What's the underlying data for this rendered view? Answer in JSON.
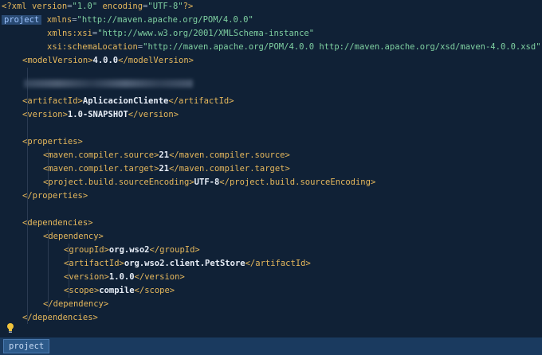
{
  "xml_decl": {
    "open": "<?",
    "name": "xml",
    "version_attr": "version",
    "version_val": "\"1.0\"",
    "encoding_attr": "encoding",
    "encoding_val": "\"UTF-8\"",
    "close": "?>"
  },
  "project": {
    "tag": "project",
    "xmlns_attr": "xmlns",
    "xmlns_val": "\"http://maven.apache.org/POM/4.0.0\"",
    "xsi_attr": "xmlns:xsi",
    "xsi_val": "\"http://www.w3.org/2001/XMLSchema-instance\"",
    "schema_attr": "xsi:schemaLocation",
    "schema_val": "\"http://maven.apache.org/POM/4.0.0 http://maven.apache.org/xsd/maven-4.0.0.xsd\""
  },
  "modelVersion": {
    "tag": "modelVersion",
    "value": "4.0.0"
  },
  "artifactId": {
    "tag": "artifactId",
    "value": "AplicacionCliente"
  },
  "version": {
    "tag": "version",
    "value": "1.0-SNAPSHOT"
  },
  "properties": {
    "tag": "properties",
    "items": [
      {
        "tag": "maven.compiler.source",
        "value": "21"
      },
      {
        "tag": "maven.compiler.target",
        "value": "21"
      },
      {
        "tag": "project.build.sourceEncoding",
        "value": "UTF-8"
      }
    ]
  },
  "dependencies": {
    "tag": "dependencies",
    "dependency_tag": "dependency",
    "groupId": {
      "tag": "groupId",
      "value": "org.wso2"
    },
    "artifactId": {
      "tag": "artifactId",
      "value": "org.wso2.client.PetStore"
    },
    "version": {
      "tag": "version",
      "value": "1.0.0"
    },
    "scope": {
      "tag": "scope",
      "value": "compile"
    }
  },
  "statusbar": {
    "breadcrumb": "project"
  },
  "colors": {
    "background": "#102136",
    "tag": "#e6b85c",
    "string": "#7fd0a1",
    "text": "#e8eef7",
    "statusbar": "#1a3a5f"
  },
  "icons": {
    "gutter": "lightbulb-icon"
  }
}
